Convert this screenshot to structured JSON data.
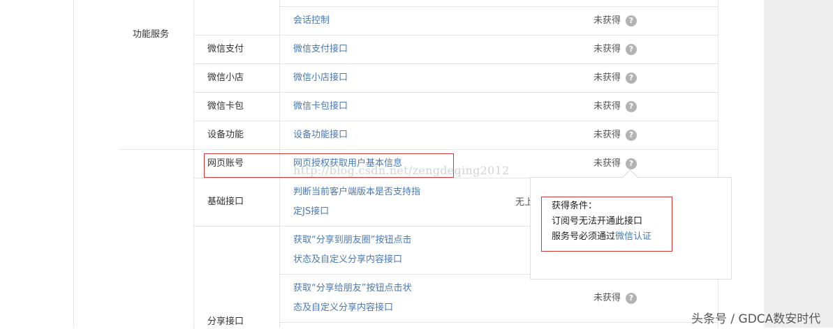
{
  "section_label": "功能服务",
  "rows": [
    {
      "category": "",
      "link": "会话控制",
      "status": "未获得"
    },
    {
      "category": "微信支付",
      "link": "微信支付接口",
      "status": "未获得"
    },
    {
      "category": "微信小店",
      "link": "微信小店接口",
      "status": "未获得"
    },
    {
      "category": "微信卡包",
      "link": "微信卡包接口",
      "status": "未获得"
    },
    {
      "category": "设备功能",
      "link": "设备功能接口",
      "status": "未获得"
    },
    {
      "category": "网页账号",
      "link": "网页授权获取用户基本信息",
      "status": "未获得"
    }
  ],
  "basic_interface": {
    "category": "基础接口",
    "link_line1": "判断当前客户端版本是否支持指",
    "link_line2": "定JS接口",
    "status_partial": "无上"
  },
  "share_interface": {
    "category": "分享接口",
    "item1_line1": "获取“分享到朋友圈”按钮点击",
    "item1_line2": "状态及自定义分享内容接口",
    "item2_line1": "获取“分享给朋友”按钮点击状",
    "item2_line2": "态及自定义分享内容接口",
    "item2_status": "未获得"
  },
  "help_glyph": "?",
  "popover": {
    "title": "获得条件：",
    "line1": "订阅号无法开通此接口",
    "line2_prefix": "服务号必须通过",
    "line2_link": "微信认证"
  },
  "watermark": "http://blog.csdn.net/zengdeqing2012",
  "corner_watermark": "头条号 / GDCA数安时代",
  "colors": {
    "link": "#4a78b4",
    "highlight_box": "#d03a3a",
    "help_icon": "#b3b3b3"
  }
}
